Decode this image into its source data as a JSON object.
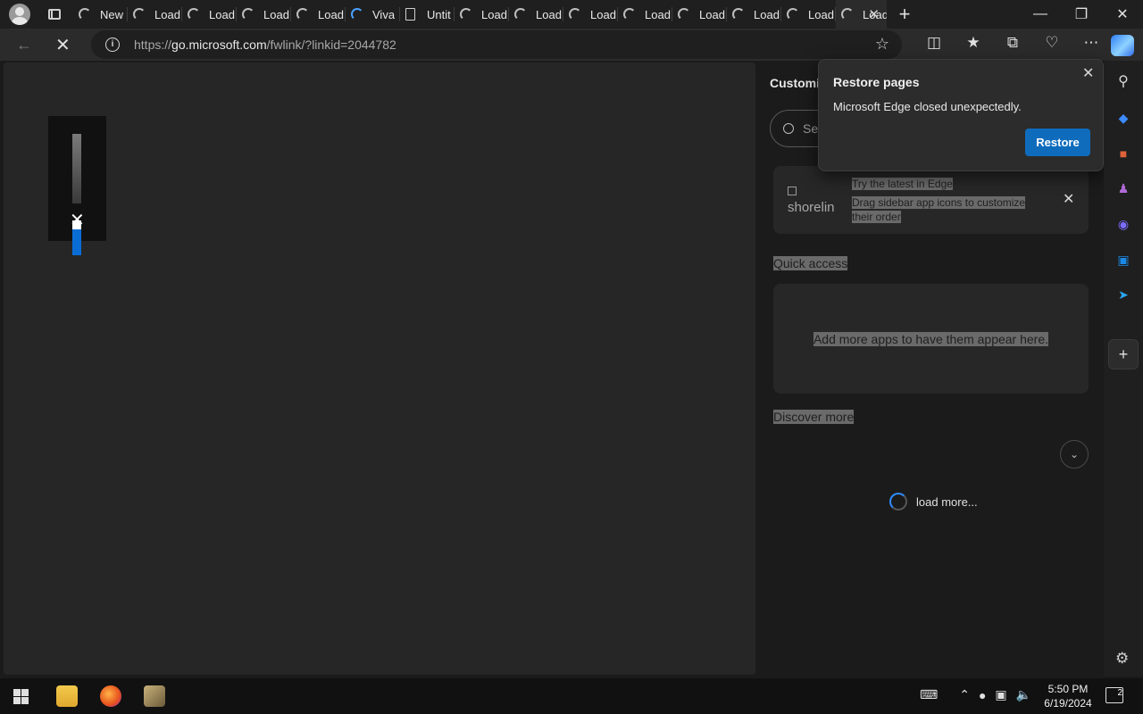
{
  "tabs": [
    {
      "label": "New",
      "icon": "spinner"
    },
    {
      "label": "Load",
      "icon": "spinner"
    },
    {
      "label": "Load",
      "icon": "spinner"
    },
    {
      "label": "Load",
      "icon": "spinner"
    },
    {
      "label": "Load",
      "icon": "spinner"
    },
    {
      "label": "Viva",
      "icon": "spinner-blue"
    },
    {
      "label": "Untit",
      "icon": "document"
    },
    {
      "label": "Load",
      "icon": "spinner"
    },
    {
      "label": "Load",
      "icon": "spinner"
    },
    {
      "label": "Load",
      "icon": "spinner"
    },
    {
      "label": "Load",
      "icon": "spinner"
    },
    {
      "label": "Load",
      "icon": "spinner"
    },
    {
      "label": "Load",
      "icon": "spinner"
    },
    {
      "label": "Load",
      "icon": "spinner"
    },
    {
      "label": "Load",
      "icon": "spinner",
      "active": true
    }
  ],
  "address": {
    "prefix": "https://",
    "host": "go.microsoft.com",
    "path": "/fwlink/?linkid=2044782"
  },
  "panel": {
    "title": "Customi",
    "search_placeholder": "Se",
    "promo_image_alt": "shorelin",
    "promo_title": "Try the latest in Edge",
    "promo_desc": "Drag sidebar app icons to customize their order",
    "quick_access_heading": "Quick access",
    "quick_access_empty": "Add more apps to have them appear here.",
    "discover_heading": "Discover more",
    "load_more": "load more..."
  },
  "popup": {
    "title": "Restore pages",
    "message": "Microsoft Edge closed unexpectedly.",
    "button": "Restore"
  },
  "volume": {
    "level": 0.4
  },
  "clock": {
    "time": "5:50 PM",
    "date": "6/19/2024"
  },
  "notifications": {
    "count": "2"
  },
  "colors": {
    "accent": "#0f6cbd",
    "background": "#262626"
  }
}
